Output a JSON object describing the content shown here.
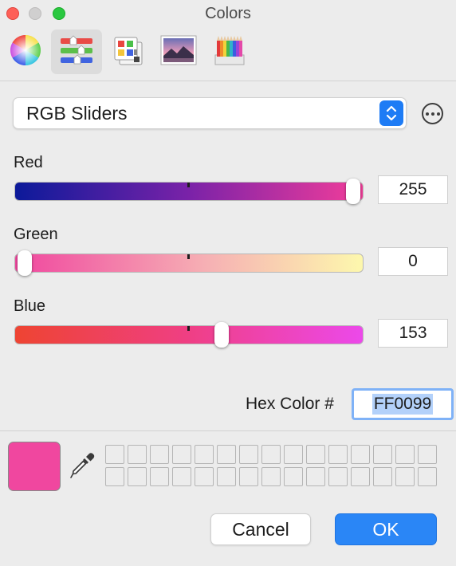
{
  "window": {
    "title": "Colors",
    "controls": [
      "close",
      "minimize",
      "zoom"
    ]
  },
  "toolbar": {
    "tabs": [
      {
        "name": "Color Wheel",
        "icon": "color-wheel-icon",
        "selected": false
      },
      {
        "name": "Color Sliders",
        "icon": "sliders-icon",
        "selected": true
      },
      {
        "name": "Color Palettes",
        "icon": "palettes-icon",
        "selected": false
      },
      {
        "name": "Image Palettes",
        "icon": "image-palettes-icon",
        "selected": false
      },
      {
        "name": "Pencils",
        "icon": "pencils-icon",
        "selected": false
      }
    ]
  },
  "mode_popup": {
    "value": "RGB Sliders",
    "icon": "up-down-arrows-icon"
  },
  "more_button": {
    "icon": "ellipsis-circle-icon"
  },
  "sliders": {
    "red": {
      "label": "Red",
      "value": "255",
      "fraction": 1.0
    },
    "green": {
      "label": "Green",
      "value": "0",
      "fraction": 0.0
    },
    "blue": {
      "label": "Blue",
      "value": "153",
      "fraction": 0.6
    }
  },
  "hex": {
    "label": "Hex Color #",
    "value": "FF0099"
  },
  "current_color": "#f0479f",
  "eyedropper": {
    "icon": "eyedropper-icon"
  },
  "swatch_grid": {
    "rows": 2,
    "columns": 15
  },
  "buttons": {
    "cancel": "Cancel",
    "ok": "OK"
  },
  "colors": {
    "accent": "#2a86f6",
    "hex_selection": "#b3d1fa"
  }
}
